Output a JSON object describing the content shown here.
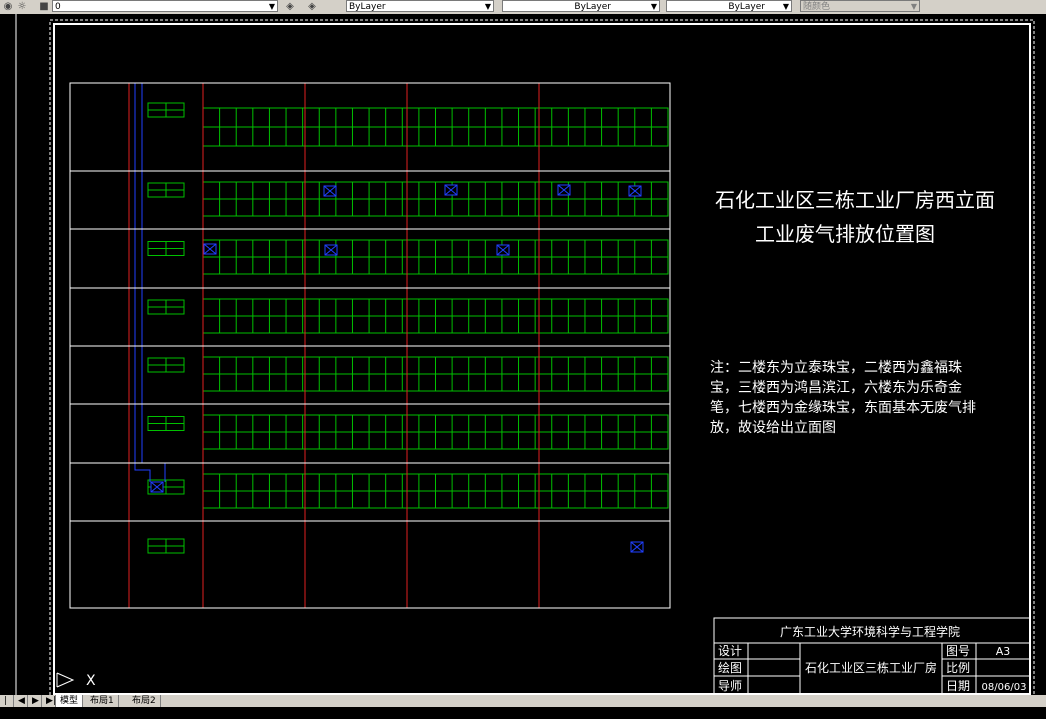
{
  "toolbar": {
    "layer_value": "0",
    "color_value": "ByLayer",
    "linetype_value": "ByLayer",
    "lineweight_value": "ByLayer",
    "plotstyle_value": "随颜色"
  },
  "drawing": {
    "title_line1": "石化工业区三栋工业厂房西立面",
    "title_line2": "工业废气排放位置图",
    "note_lines": [
      "注：二楼东为立泰珠宝，二楼西为鑫福珠",
      "宝，三楼西为鸿昌滨江，六楼东为乐奇金",
      "笔，七楼西为金缘珠宝，东面基本无废气排",
      "放，故设给出立面图"
    ],
    "titleblock": {
      "institution": "广东工业大学环境科学与工程学院",
      "label_design": "设计",
      "label_draw": "绘图",
      "label_advisor": "导师",
      "project": "石化工业区三栋工业厂房",
      "label_drawing_no": "图号",
      "drawing_no": "A3",
      "label_scale": "比例",
      "scale": "",
      "label_date": "日期",
      "date": "08/06/03"
    },
    "ucs_label": "X"
  },
  "layout_tabs": [
    "模型",
    "布局1",
    "布局2"
  ],
  "colors": {
    "background": "#000000",
    "frame": "#ffffff",
    "window_grid": "#00c000",
    "pillar": "#e02020",
    "duct": "#2040ff",
    "toolbar": "#d4d0c8"
  }
}
